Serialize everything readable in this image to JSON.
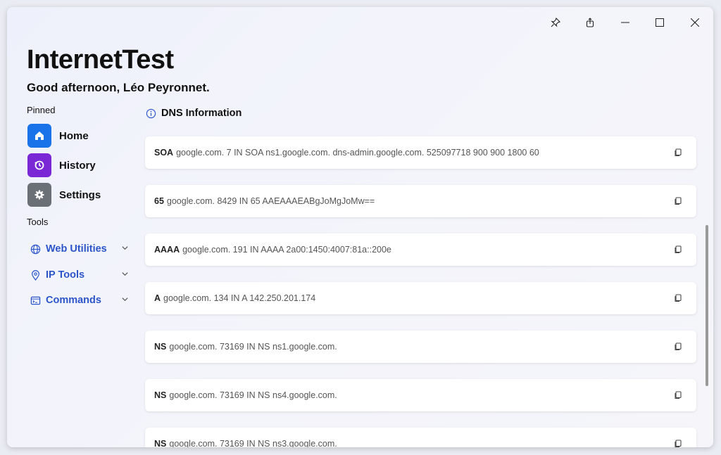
{
  "app": {
    "title": "InternetTest",
    "greeting": "Good afternoon, Léo Peyronnet."
  },
  "sidebar": {
    "pinned_label": "Pinned",
    "pinned": [
      {
        "label": "Home",
        "icon": "home-icon",
        "color": "#1a73e8"
      },
      {
        "label": "History",
        "icon": "history-icon",
        "color": "#7a28d6"
      },
      {
        "label": "Settings",
        "icon": "gear-icon",
        "color": "#6b6f76"
      }
    ],
    "tools_label": "Tools",
    "tools": [
      {
        "label": "Web Utilities",
        "icon": "globe-icon"
      },
      {
        "label": "IP Tools",
        "icon": "location-pin-icon"
      },
      {
        "label": "Commands",
        "icon": "terminal-icon"
      }
    ]
  },
  "main": {
    "section_title": "DNS Information",
    "records": [
      {
        "type": "SOA",
        "value": "google.com. 7 IN SOA ns1.google.com. dns-admin.google.com. 525097718 900 900 1800 60"
      },
      {
        "type": "65",
        "value": "google.com. 8429 IN 65 AAEAAAEABgJoMgJoMw=="
      },
      {
        "type": "AAAA",
        "value": "google.com. 191 IN AAAA 2a00:1450:4007:81a::200e"
      },
      {
        "type": "A",
        "value": "google.com. 134 IN A 142.250.201.174"
      },
      {
        "type": "NS",
        "value": "google.com. 73169 IN NS ns1.google.com."
      },
      {
        "type": "NS",
        "value": "google.com. 73169 IN NS ns4.google.com."
      },
      {
        "type": "NS",
        "value": "google.com. 73169 IN NS ns3.google.com."
      }
    ]
  },
  "colors": {
    "accent": "#2b55c9",
    "card": "#ffffff"
  }
}
